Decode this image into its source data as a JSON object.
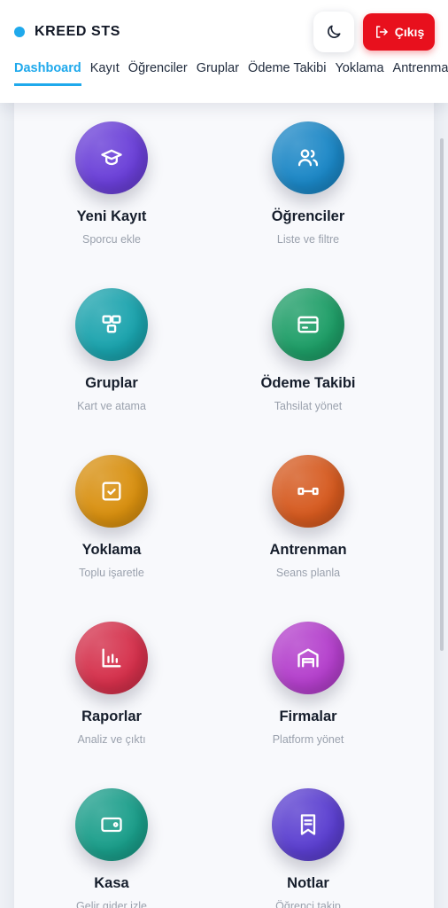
{
  "app": {
    "brand_name": "KREED STS"
  },
  "header": {
    "logout_label": "Çıkış"
  },
  "nav": {
    "tabs": [
      {
        "label": "Dashboard",
        "active": true
      },
      {
        "label": "Kayıt"
      },
      {
        "label": "Öğrenciler"
      },
      {
        "label": "Gruplar"
      },
      {
        "label": "Ödeme Takibi"
      },
      {
        "label": "Yoklama"
      },
      {
        "label": "Antrenman"
      }
    ]
  },
  "tiles": [
    {
      "title": "Yeni Kayıt",
      "subtitle": "Sporcu ekle",
      "icon": "graduation-cap-icon",
      "color": "#6a3fd8"
    },
    {
      "title": "Öğrenciler",
      "subtitle": "Liste ve filtre",
      "icon": "users-icon",
      "color": "#1b87c6"
    },
    {
      "title": "Gruplar",
      "subtitle": "Kart ve atama",
      "icon": "groups-icon",
      "color": "#1aa3ad"
    },
    {
      "title": "Ödeme Takibi",
      "subtitle": "Tahsilat yönet",
      "icon": "credit-card-icon",
      "color": "#1e9e67"
    },
    {
      "title": "Yoklama",
      "subtitle": "Toplu işaretle",
      "icon": "checkbox-icon",
      "color": "#d9900f"
    },
    {
      "title": "Antrenman",
      "subtitle": "Seans planla",
      "icon": "dumbbell-icon",
      "color": "#d65a1f"
    },
    {
      "title": "Raporlar",
      "subtitle": "Analiz ve çıktı",
      "icon": "bar-chart-icon",
      "color": "#d5304b"
    },
    {
      "title": "Firmalar",
      "subtitle": "Platform yönet",
      "icon": "warehouse-icon",
      "color": "#b43fcc"
    },
    {
      "title": "Kasa",
      "subtitle": "Gelir gider izle",
      "icon": "wallet-icon",
      "color": "#1a9e8a"
    },
    {
      "title": "Notlar",
      "subtitle": "Öğrenci takip",
      "icon": "notes-icon",
      "color": "#5b3fd0"
    }
  ]
}
